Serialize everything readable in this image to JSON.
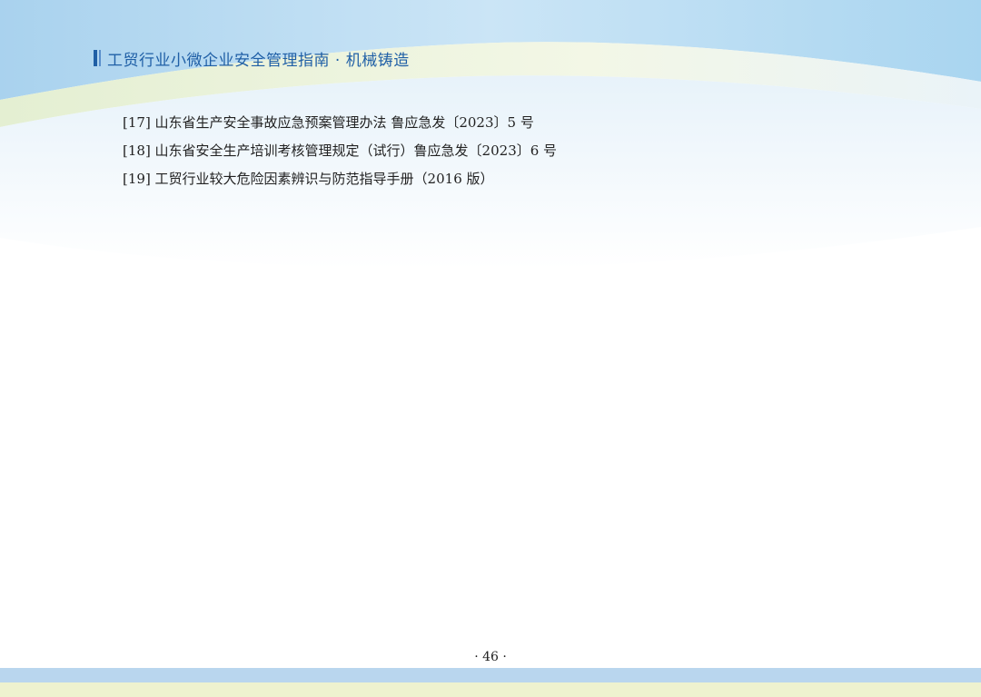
{
  "header": {
    "title": "工贸行业小微企业安全管理指南 · 机械铸造"
  },
  "references": [
    "[17] 山东省生产安全事故应急预案管理办法 鲁应急发〔2023〕5 号",
    "[18] 山东省安全生产培训考核管理规定（试行）鲁应急发〔2023〕6 号",
    "[19] 工贸行业较大危险因素辨识与防范指导手册（2016 版）"
  ],
  "footer": {
    "page_number": "· 46 ·"
  },
  "colors": {
    "header_accent": "#1f5fa6",
    "wave_light_blue": "#cfe6f5",
    "wave_green": "#eef5d6",
    "footer_blue": "#b9d6ee",
    "footer_yellow": "#eef2cf"
  }
}
